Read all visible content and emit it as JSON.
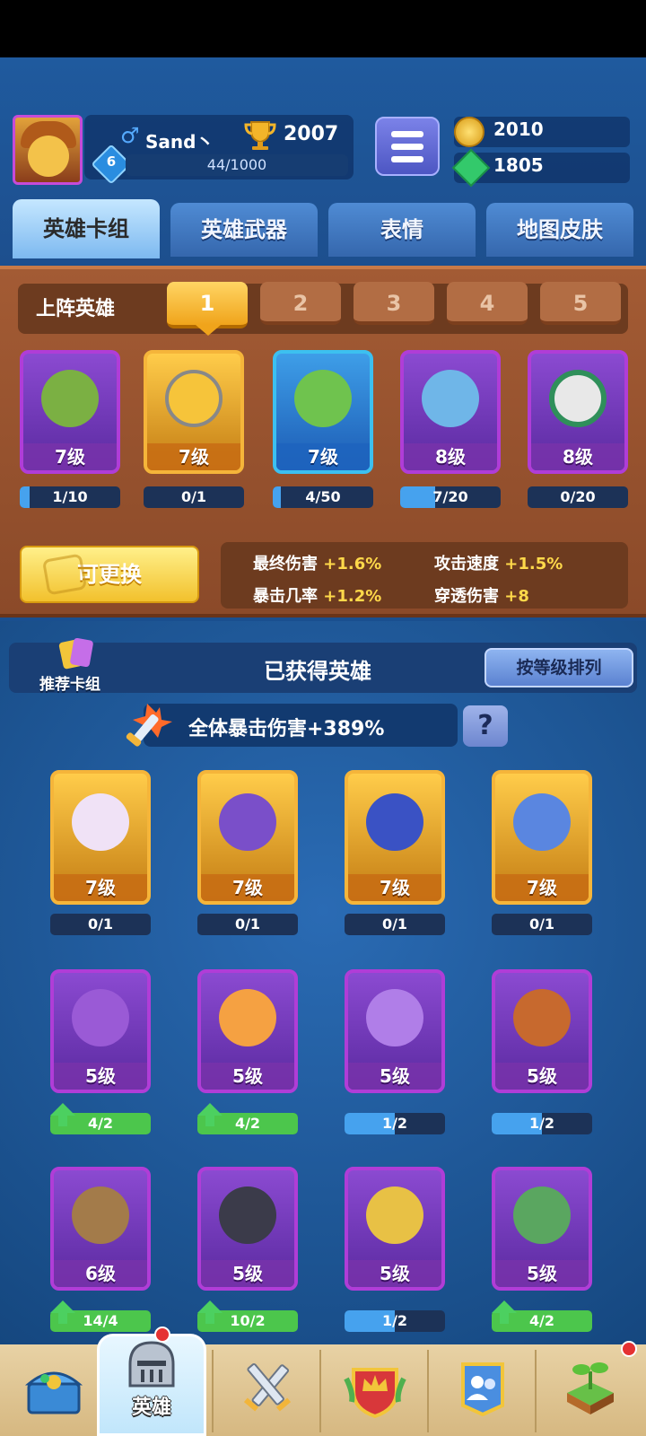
{
  "player": {
    "name": "Sand丶",
    "gender_symbol": "♂",
    "trophies": "2007",
    "level": "6",
    "xp": "44/1000"
  },
  "resources": {
    "gold": "2010",
    "gems": "1805"
  },
  "tabs": [
    "英雄卡组",
    "英雄武器",
    "表情",
    "地图皮肤"
  ],
  "deck": {
    "label": "上阵英雄",
    "slots": [
      "1",
      "2",
      "3",
      "4",
      "5"
    ],
    "active_slot": "1",
    "heroes": [
      {
        "level": "7级",
        "progress": "1/10",
        "progress_fraction": 0.1
      },
      {
        "level": "7级",
        "progress": "0/1",
        "progress_fraction": 0
      },
      {
        "level": "7级",
        "progress": "4/50",
        "progress_fraction": 0.08
      },
      {
        "level": "8级",
        "progress": "7/20",
        "progress_fraction": 0.35
      },
      {
        "level": "8级",
        "progress": "0/20",
        "progress_fraction": 0
      }
    ],
    "replace_label": "可更换",
    "stats": [
      {
        "label": "最终伤害",
        "value": "+1.6%"
      },
      {
        "label": "攻击速度",
        "value": "+1.5%"
      },
      {
        "label": "暴击几率",
        "value": "+1.2%"
      },
      {
        "label": "穿透伤害",
        "value": "+8"
      }
    ]
  },
  "collection": {
    "recommend_label": "推荐卡组",
    "title": "已获得英雄",
    "sort_label": "按等级排列",
    "crit_bonus": "全体暴击伤害+389%",
    "help_glyph": "?"
  },
  "heroes": [
    {
      "level": "7级",
      "progress": "0/1",
      "rarity": "gold"
    },
    {
      "level": "7级",
      "progress": "0/1",
      "rarity": "gold"
    },
    {
      "level": "7级",
      "progress": "0/1",
      "rarity": "gold"
    },
    {
      "level": "7级",
      "progress": "0/1",
      "rarity": "gold"
    },
    {
      "level": "5级",
      "progress": "4/2",
      "rarity": "purple",
      "upgradable": true
    },
    {
      "level": "5级",
      "progress": "4/2",
      "rarity": "purple",
      "upgradable": true
    },
    {
      "level": "5级",
      "progress": "1/2",
      "rarity": "purple"
    },
    {
      "level": "5级",
      "progress": "1/2",
      "rarity": "purple"
    },
    {
      "level": "6级",
      "progress": "14/4",
      "rarity": "purple",
      "upgradable": true
    },
    {
      "level": "5级",
      "progress": "10/2",
      "rarity": "purple",
      "upgradable": true
    },
    {
      "level": "5级",
      "progress": "1/2",
      "rarity": "purple"
    },
    {
      "level": "5级",
      "progress": "4/2",
      "rarity": "purple",
      "upgradable": true
    }
  ],
  "nav": {
    "heroes_label": "英雄",
    "icons": [
      "treasure-chest-icon",
      "knight-helmet-icon",
      "crossed-swords-icon",
      "crown-shield-icon",
      "friends-banner-icon",
      "sprout-island-icon"
    ]
  },
  "colors": {
    "background": "#1a4f8f",
    "wood_panel": "#a35b34",
    "gold_accent": "#f2c12d",
    "progress_blue": "#46a2ee",
    "progress_green": "#4cc64c"
  }
}
